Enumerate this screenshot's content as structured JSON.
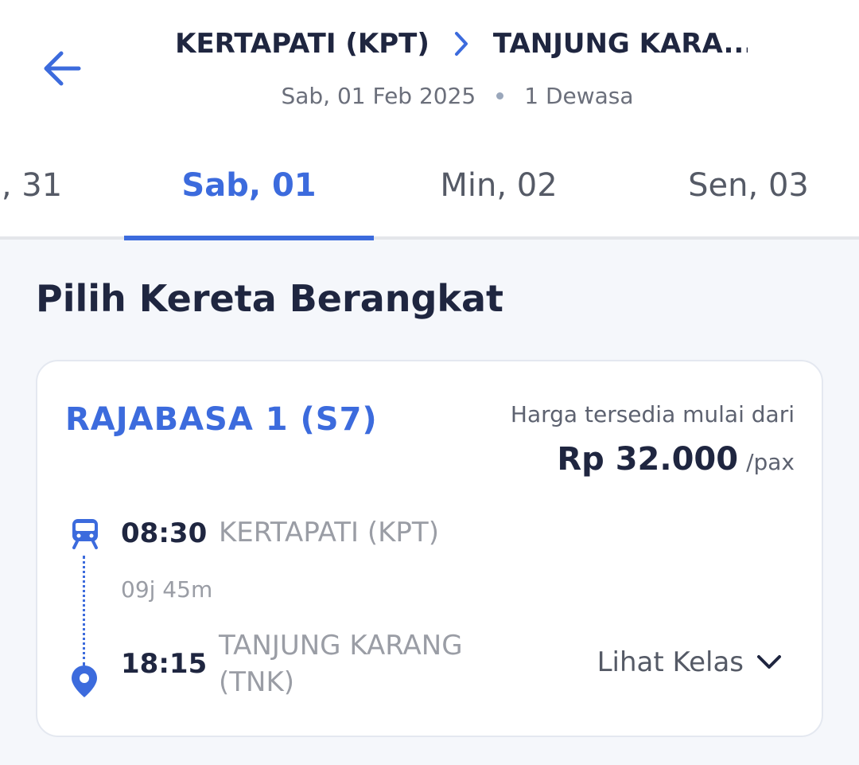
{
  "header": {
    "origin": "KERTAPATI (KPT)",
    "destination": "TANJUNG KARA...",
    "date": "Sab, 01 Feb 2025",
    "passengers": "1 Dewasa"
  },
  "date_tabs": [
    {
      "label": ", 31",
      "active": false
    },
    {
      "label": "Sab, 01",
      "active": true
    },
    {
      "label": "Min, 02",
      "active": false
    },
    {
      "label": "Sen, 03",
      "active": false
    }
  ],
  "section_title": "Pilih Kereta Berangkat",
  "train": {
    "name": "RAJABASA 1 (S7)",
    "price_caption": "Harga tersedia mulai dari",
    "price": "Rp 32.000",
    "price_unit": "/pax",
    "departure_time": "08:30",
    "departure_station": "KERTAPATI (KPT)",
    "duration": "09j 45m",
    "arrival_time": "18:15",
    "arrival_station_line1": "TANJUNG KARANG",
    "arrival_station_line2": "(TNK)",
    "view_class_label": "Lihat Kelas"
  },
  "colors": {
    "accent": "#3c6bdd",
    "text_dark": "#1f2640",
    "text_muted": "#9a9da5",
    "background": "#f5f7fb"
  },
  "icons": {
    "back": "arrow-left-icon",
    "route_separator": "chevron-right-icon",
    "train": "train-icon",
    "pin": "location-pin-icon",
    "expand": "chevron-down-icon"
  }
}
